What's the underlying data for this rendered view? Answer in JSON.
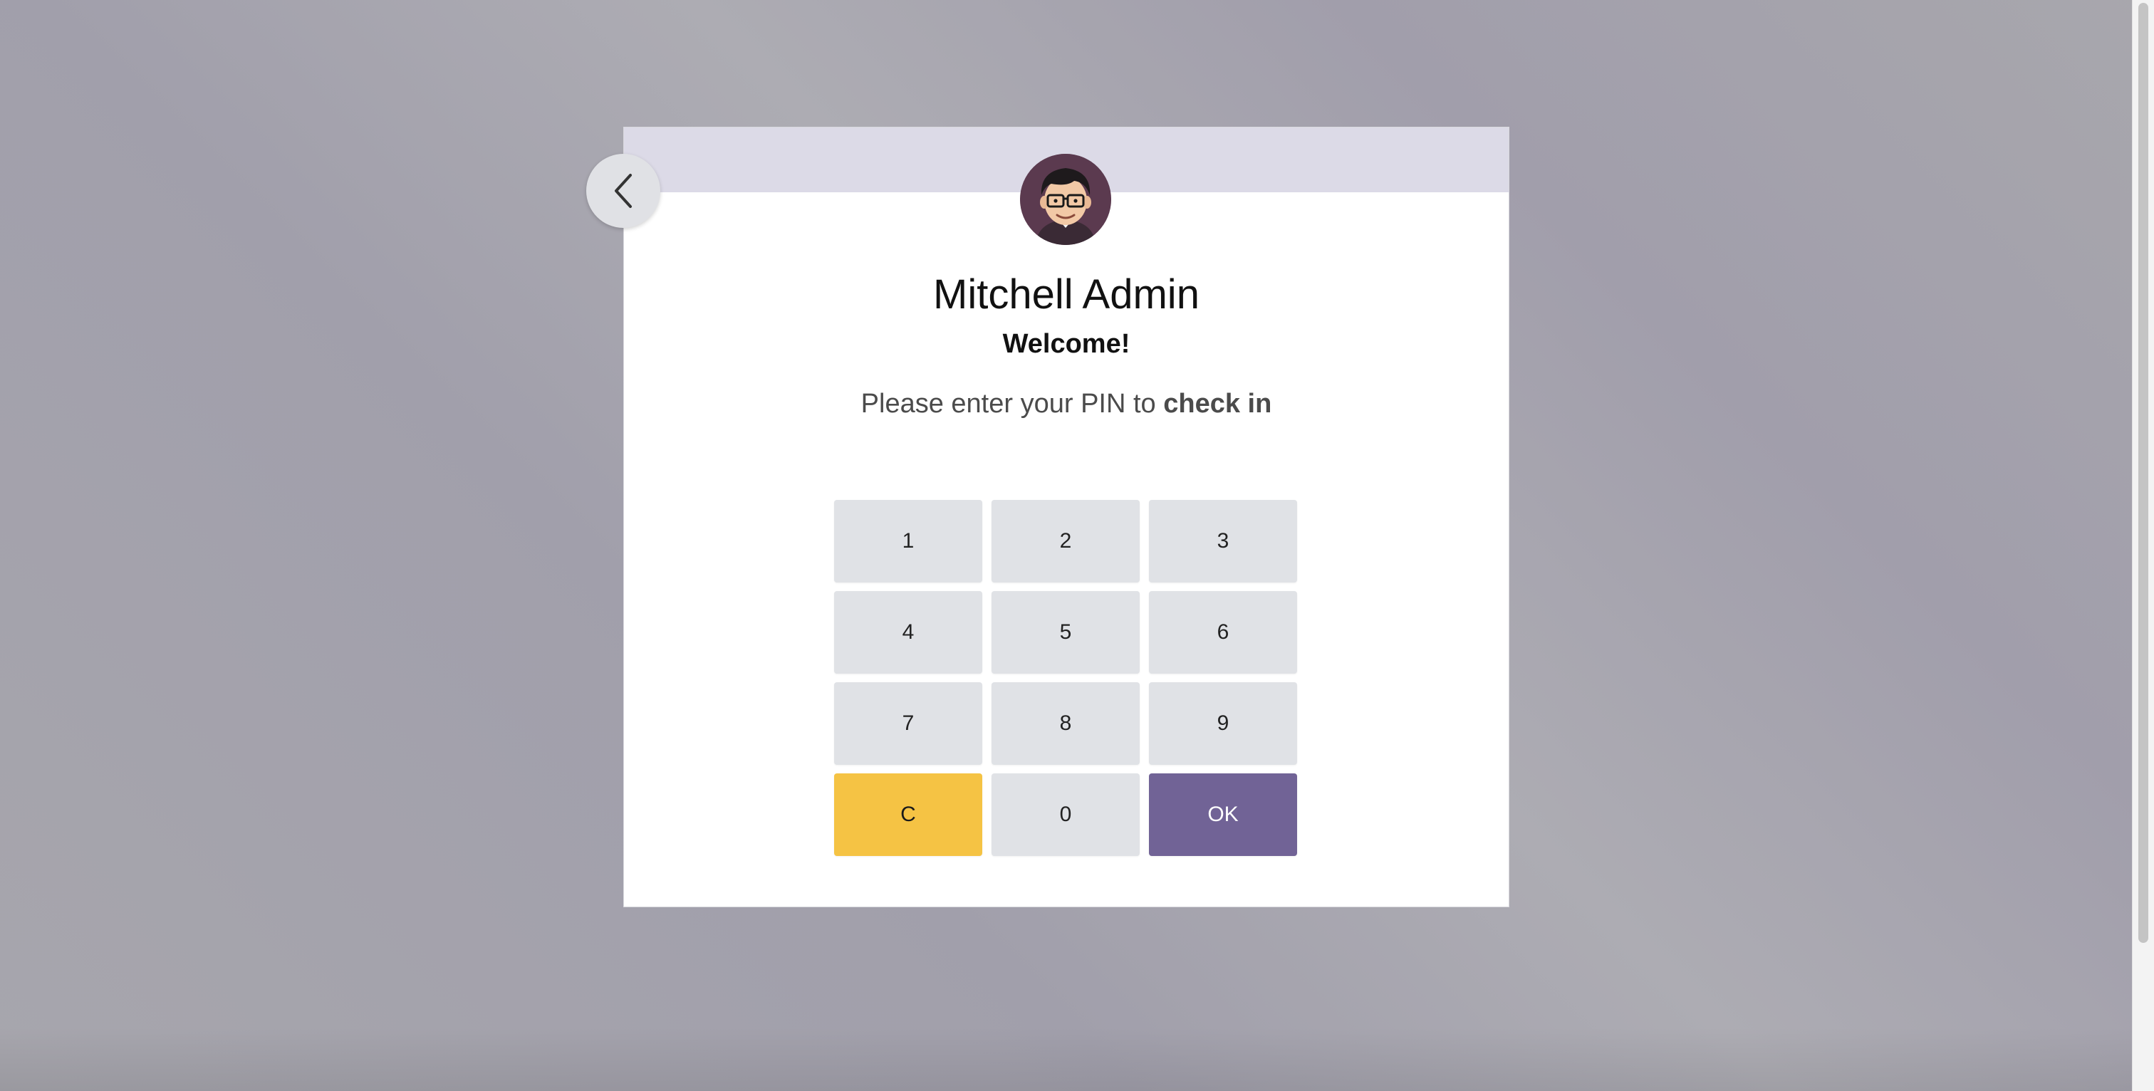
{
  "employee": {
    "name": "Mitchell Admin",
    "greeting": "Welcome!"
  },
  "instruction": {
    "prefix": "Please enter your PIN to ",
    "action": "check in"
  },
  "keypad": {
    "keys": [
      "1",
      "2",
      "3",
      "4",
      "5",
      "6",
      "7",
      "8",
      "9"
    ],
    "clear_label": "C",
    "zero_label": "0",
    "ok_label": "OK"
  },
  "icons": {
    "back": "chevron-left-icon",
    "avatar": "avatar"
  },
  "colors": {
    "header_band": "#dcdae7",
    "key_default": "#e0e2e6",
    "key_clear": "#f5c344",
    "key_ok": "#716396"
  }
}
